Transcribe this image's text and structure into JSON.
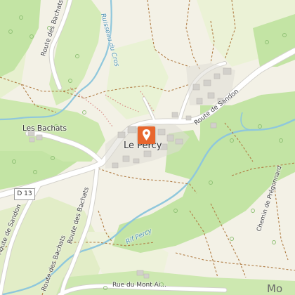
{
  "map": {
    "village_label": "Le Percy",
    "places": {
      "les_bachats": "Les Bachats",
      "mo_partial": "Mo"
    },
    "roads": {
      "d13_shield": "D 13",
      "route_des_bachats_north": "Route des Bachats",
      "route_des_bachats_mid": "Route des Bachats",
      "route_des_bachats_south": "Route des Bachats",
      "route_de_sandon_east": "Route de Sandon",
      "route_de_sandon_west": "Route de Sandon",
      "chemin_de_pregonnard": "Chemin de Prégonnard",
      "rue_du_mont_aiguille": "Rue du Mont Ai..."
    },
    "water": {
      "ruisseau_du_cros": "Ruisseau du Cros",
      "rif_percy": "Rif Percy"
    },
    "marker_icon": "location-pin-icon",
    "colors": {
      "background": "#f3f1e6",
      "forest": "#c3e4a4",
      "meadow": "#e7f0cf",
      "road": "#ffffff",
      "water": "#8fc7dc",
      "marker": "#e8662d",
      "building": "#d2d0cb",
      "path": "#b07c44",
      "track": "#d98a84"
    }
  }
}
